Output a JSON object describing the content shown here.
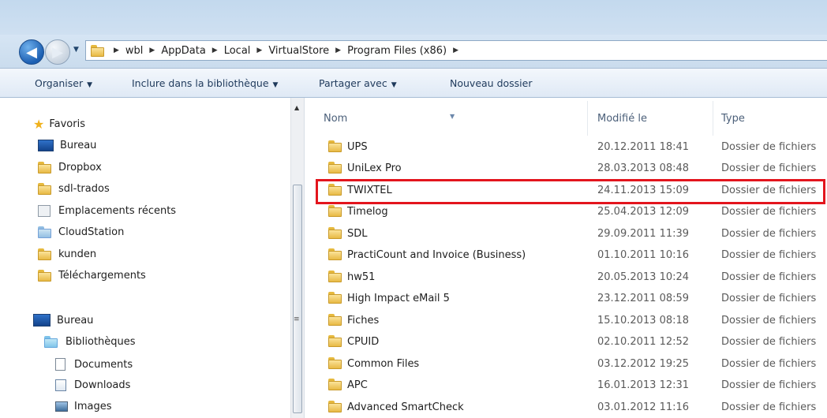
{
  "address": {
    "crumbs": [
      "wbl",
      "AppData",
      "Local",
      "VirtualStore",
      "Program Files (x86)"
    ]
  },
  "toolbar": {
    "organise": "Organiser",
    "include": "Inclure dans la bibliothèque",
    "share": "Partager avec",
    "new_folder": "Nouveau dossier"
  },
  "nav": {
    "favorites_header": "Favoris",
    "favorites": [
      {
        "label": "Bureau",
        "icon": "desktop-icon"
      },
      {
        "label": "Dropbox",
        "icon": "folder-icon"
      },
      {
        "label": "sdl-trados",
        "icon": "folder-icon"
      },
      {
        "label": "Emplacements récents",
        "icon": "recent-places-icon"
      },
      {
        "label": "CloudStation",
        "icon": "cloud-folder-icon"
      },
      {
        "label": "kunden",
        "icon": "folder-icon"
      },
      {
        "label": "Téléchargements",
        "icon": "downloads-folder-icon"
      }
    ],
    "desktop_header": "Bureau",
    "libraries": "Bibliothèques",
    "library_items": [
      {
        "label": "Documents",
        "icon": "documents-icon"
      },
      {
        "label": "Downloads",
        "icon": "downloads-icon"
      },
      {
        "label": "Images",
        "icon": "images-icon"
      }
    ]
  },
  "columns": {
    "name": "Nom",
    "modified": "Modifié le",
    "type": "Type"
  },
  "files": [
    {
      "name": "UPS",
      "modified": "20.12.2011 18:41",
      "type": "Dossier de fichiers"
    },
    {
      "name": "UniLex Pro",
      "modified": "28.03.2013 08:48",
      "type": "Dossier de fichiers"
    },
    {
      "name": "TWIXTEL",
      "modified": "24.11.2013 15:09",
      "type": "Dossier de fichiers"
    },
    {
      "name": "Timelog",
      "modified": "25.04.2013 12:09",
      "type": "Dossier de fichiers"
    },
    {
      "name": "SDL",
      "modified": "29.09.2011 11:39",
      "type": "Dossier de fichiers"
    },
    {
      "name": "PractiCount and Invoice (Business)",
      "modified": "01.10.2011 10:16",
      "type": "Dossier de fichiers"
    },
    {
      "name": "hw51",
      "modified": "20.05.2013 10:24",
      "type": "Dossier de fichiers"
    },
    {
      "name": "High Impact eMail 5",
      "modified": "23.12.2011 08:59",
      "type": "Dossier de fichiers"
    },
    {
      "name": "Fiches",
      "modified": "15.10.2013 08:18",
      "type": "Dossier de fichiers"
    },
    {
      "name": "CPUID",
      "modified": "02.10.2011 12:52",
      "type": "Dossier de fichiers"
    },
    {
      "name": "Common Files",
      "modified": "03.12.2012 19:25",
      "type": "Dossier de fichiers"
    },
    {
      "name": "APC",
      "modified": "16.01.2013 12:31",
      "type": "Dossier de fichiers"
    },
    {
      "name": "Advanced SmartCheck",
      "modified": "03.01.2012 11:16",
      "type": "Dossier de fichiers"
    }
  ]
}
